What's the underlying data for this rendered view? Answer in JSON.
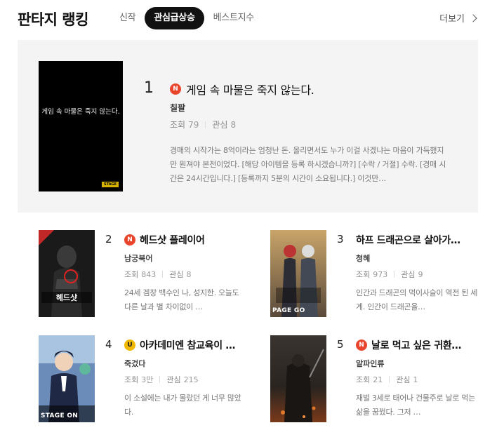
{
  "header": {
    "title": "판타지 랭킹",
    "tabs": [
      "신작",
      "관심급상승",
      "베스트지수"
    ],
    "active_tab": "관심급상승",
    "more_label": "더보기"
  },
  "stat_labels": {
    "views": "조회",
    "interest": "관심"
  },
  "featured": {
    "rank": "1",
    "badge": "N",
    "title": "게임 속 마물은 죽지 않는다.",
    "author": "칠팔",
    "views": "79",
    "interest": "8",
    "description": "경매의 시작가는 8억이라는 엄청난 돈. 올리면서도 누가 이걸 사겠냐는 마음이 가득했지만 뭔져야 본전이었다. [해당 아이템을 등록 하시겠습니까?] [수락 / 거절] 수락. [경매 시간은 24시간입니다.] [등록까지 5분의 시간이 소요됩니다.] 이것만…",
    "cover_text": "게임 속 마물은 죽지 않는다.",
    "cover_badge": "STAGE"
  },
  "cards": [
    {
      "rank": "2",
      "badge": "N",
      "title": "헤드샷 플레이어",
      "author": "남궁북어",
      "views": "843",
      "interest": "8",
      "description": "24세 겜창 백수인 나, 성지한. 오늘도 다른 날과 별 차이없이 …",
      "cover_tag": ""
    },
    {
      "rank": "3",
      "badge": "",
      "title": "하프 드래곤으로 살아가…",
      "author": "청혜",
      "views": "973",
      "interest": "9",
      "description": "인간과 드래곤의 먹이사슬이 역전 된 세계. 인간이 드래곤을…",
      "cover_tag": "PAGE GO"
    },
    {
      "rank": "4",
      "badge": "U",
      "title": "아카데미엔 참교육이 …",
      "author": "죽겄다",
      "views": "3만",
      "interest": "215",
      "description": "이 소설에는 내가 몰랐던 게 너무 많았다.",
      "cover_tag": "STAGE ON"
    },
    {
      "rank": "5",
      "badge": "N",
      "title": "날로 먹고 싶은 귀환…",
      "author": "알파인류",
      "views": "21",
      "interest": "1",
      "description": "재벌 3세로 태어나 건물주로 날로 먹는 삶을 꿈꿨다. 그저 …",
      "cover_tag": ""
    }
  ]
}
